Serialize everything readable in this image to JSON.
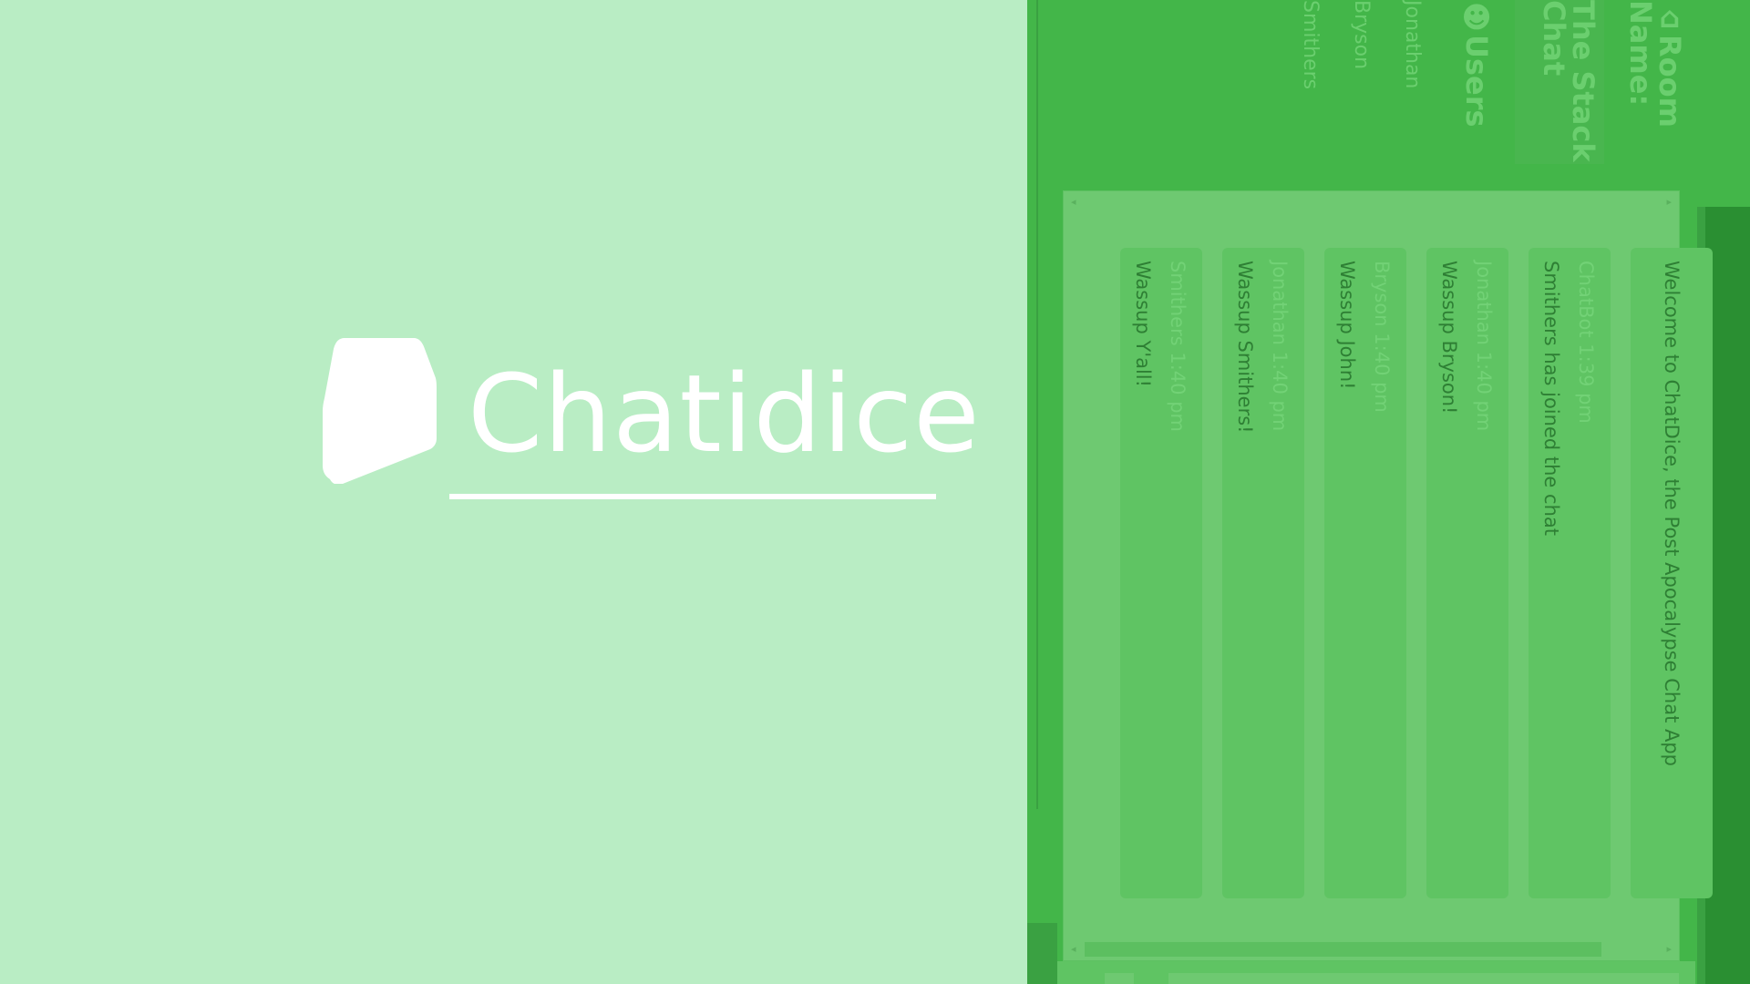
{
  "brand": {
    "name": "Chatidice"
  },
  "sidebar": {
    "room_label": "Room Name:",
    "room_name": "The Stack Chat",
    "users_label": "Users",
    "users": [
      "Jonathan",
      "Bryson",
      "Smithers"
    ]
  },
  "messages": [
    {
      "author": "",
      "time": "",
      "text": "Welcome to ChatDice, the Post Apocalypse Chat App"
    },
    {
      "author": "ChatBot",
      "time": "1:39 pm",
      "text": "Smithers has joined the chat"
    },
    {
      "author": "Jonathan",
      "time": "1:40 pm",
      "text": "Wassup Bryson!"
    },
    {
      "author": "Bryson",
      "time": "1:40 pm",
      "text": "Wassup John!"
    },
    {
      "author": "Jonathan",
      "time": "1:40 pm",
      "text": "Wassup Smithers!"
    },
    {
      "author": "Smithers",
      "time": "1:40 pm",
      "text": "Wassup Y'all!"
    }
  ],
  "colors": {
    "left_bg": "#b9edc4",
    "app_green": "#43b649",
    "chat_bg": "#6ec971",
    "bubble": "#5fc463",
    "text_dark": "#2e7f34"
  }
}
